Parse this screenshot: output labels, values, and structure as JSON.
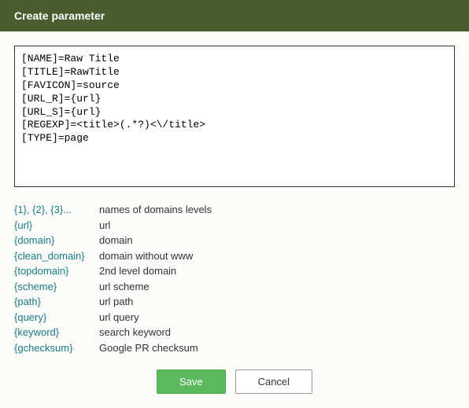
{
  "header": {
    "title": "Create parameter"
  },
  "textarea": {
    "value": "[NAME]=Raw Title\n[TITLE]=RawTitle\n[FAVICON]=source\n[URL_R]={url}\n[URL_S]={url}\n[REGEXP]=<title>(.*?)<\\/title>\n[TYPE]=page"
  },
  "help": [
    {
      "token": "{1}, {2}, {3}...",
      "desc": "names of domains levels"
    },
    {
      "token": "{url}",
      "desc": "url"
    },
    {
      "token": "{domain}",
      "desc": "domain"
    },
    {
      "token": "{clean_domain}",
      "desc": "domain without www"
    },
    {
      "token": "{topdomain}",
      "desc": "2nd level domain"
    },
    {
      "token": "{scheme}",
      "desc": "url scheme"
    },
    {
      "token": "{path}",
      "desc": "url path"
    },
    {
      "token": "{query}",
      "desc": "url query"
    },
    {
      "token": "{keyword}",
      "desc": "search keyword"
    },
    {
      "token": "{gchecksum}",
      "desc": "Google PR checksum"
    }
  ],
  "buttons": {
    "save": "Save",
    "cancel": "Cancel"
  }
}
